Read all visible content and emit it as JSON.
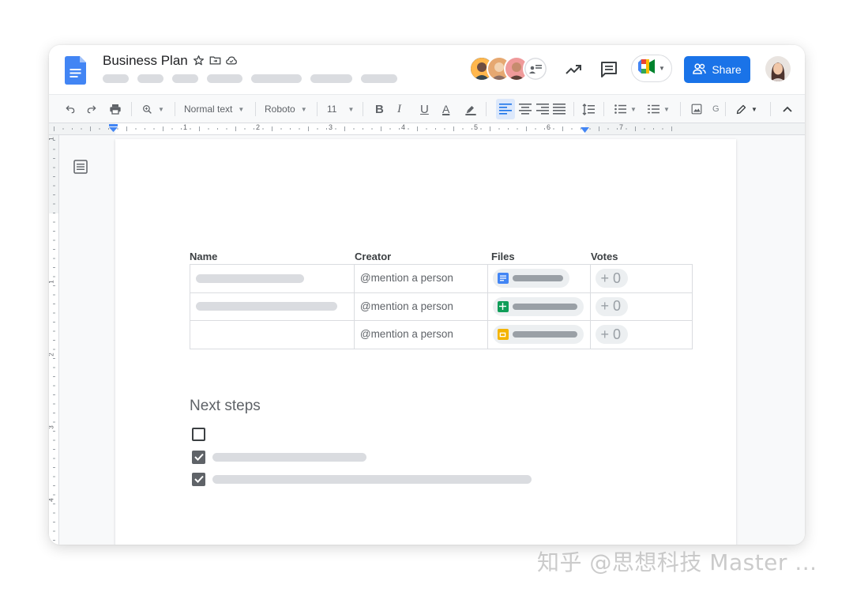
{
  "document": {
    "title": "Business Plan",
    "share_label": "Share"
  },
  "toolbar": {
    "style_label": "Normal text",
    "font_label": "Roboto",
    "size_label": "11",
    "bold": "B",
    "italic": "I",
    "underline": "U",
    "text_color": "A"
  },
  "ruler": {
    "numbers": [
      "1",
      "2",
      "3",
      "4",
      "5",
      "6",
      "7"
    ],
    "vertical_numbers": [
      "1",
      "1",
      "2",
      "3",
      "4"
    ]
  },
  "table": {
    "headers": [
      "Name",
      "Creator",
      "Files",
      "Votes"
    ],
    "rows": [
      {
        "creator": "@mention a person",
        "file_type": "docs",
        "votes": "0"
      },
      {
        "creator": "@mention a person",
        "file_type": "sheets",
        "votes": "0"
      },
      {
        "creator": "@mention a person",
        "file_type": "slides",
        "votes": "0"
      }
    ],
    "vote_prefix": "+"
  },
  "next_steps": {
    "title": "Next steps",
    "items": [
      {
        "checked": false
      },
      {
        "checked": true
      },
      {
        "checked": true
      }
    ]
  },
  "colors": {
    "accent": "#1a73e8",
    "docs_blue": "#4285f4",
    "sheets_green": "#0f9d58",
    "slides_yellow": "#f4b400"
  },
  "watermark": "知乎 @思想科技 Master ..."
}
